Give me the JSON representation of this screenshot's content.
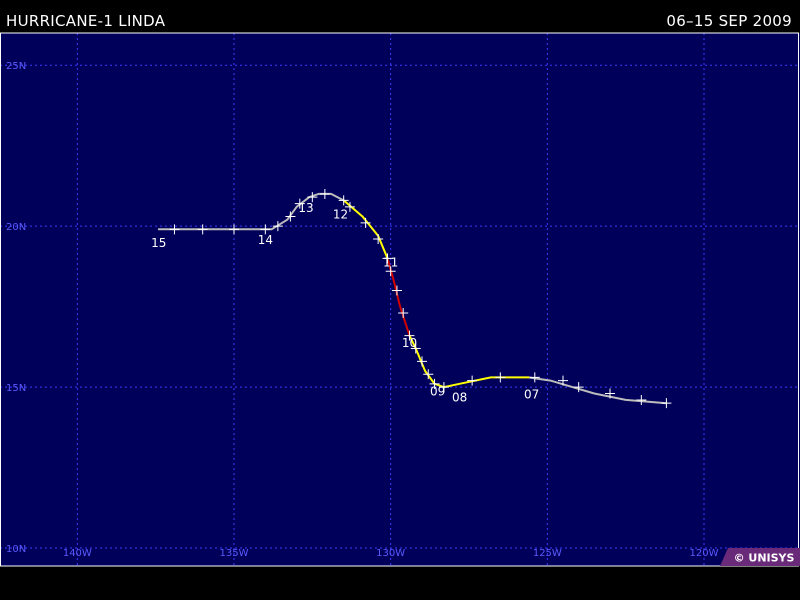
{
  "header": {
    "storm_name": "HURRICANE-1 LINDA",
    "dates": "06–15 SEP 2009"
  },
  "map": {
    "lon_range": [
      -141,
      -117
    ],
    "lat_range": [
      10,
      26
    ],
    "lon_ticks": [
      {
        "value": -140,
        "label": "140W"
      },
      {
        "value": -135,
        "label": "135W"
      },
      {
        "value": -130,
        "label": "130W"
      },
      {
        "value": -125,
        "label": "125W"
      },
      {
        "value": -120,
        "label": "120W"
      }
    ],
    "lat_ticks": [
      {
        "value": 10,
        "label": "10N"
      },
      {
        "value": 15,
        "label": "15N"
      },
      {
        "value": 20,
        "label": "20N"
      },
      {
        "value": 25,
        "label": "25N"
      }
    ],
    "colors": {
      "ocean": "#00005a",
      "grid": "#3b3bff",
      "tropical_storm": "#ffff00",
      "hurricane_1": "#d40000",
      "extratropical_or_depression": "#bcbcbc",
      "marker": "#ffffff"
    }
  },
  "track": {
    "segments": [
      {
        "category": "depression",
        "color_key": "extratropical_or_depression",
        "points": [
          [
            -121.2,
            14.5
          ],
          [
            -122.5,
            14.6
          ],
          [
            -123.5,
            14.8
          ],
          [
            -124.2,
            15.0
          ],
          [
            -124.9,
            15.2
          ],
          [
            -125.6,
            15.3
          ]
        ]
      },
      {
        "category": "tropical_storm",
        "color_key": "tropical_storm",
        "points": [
          [
            -125.6,
            15.3
          ],
          [
            -126.8,
            15.3
          ],
          [
            -127.8,
            15.1
          ],
          [
            -128.3,
            15.0
          ],
          [
            -128.6,
            15.1
          ],
          [
            -128.9,
            15.5
          ],
          [
            -129.2,
            16.2
          ],
          [
            -129.4,
            16.6
          ]
        ]
      },
      {
        "category": "hurricane_1",
        "color_key": "hurricane_1",
        "points": [
          [
            -129.4,
            16.6
          ],
          [
            -129.7,
            17.5
          ],
          [
            -129.9,
            18.3
          ],
          [
            -130.1,
            19.0
          ]
        ]
      },
      {
        "category": "tropical_storm",
        "color_key": "tropical_storm",
        "points": [
          [
            -130.1,
            19.0
          ],
          [
            -130.4,
            19.7
          ],
          [
            -130.9,
            20.3
          ],
          [
            -131.5,
            20.8
          ]
        ]
      },
      {
        "category": "depression",
        "color_key": "extratropical_or_depression",
        "points": [
          [
            -131.5,
            20.8
          ],
          [
            -131.9,
            21.0
          ],
          [
            -132.3,
            21.0
          ],
          [
            -132.6,
            20.9
          ],
          [
            -133.0,
            20.6
          ],
          [
            -133.3,
            20.2
          ],
          [
            -133.8,
            19.9
          ],
          [
            -134.5,
            19.9
          ],
          [
            -135.5,
            19.9
          ],
          [
            -136.5,
            19.9
          ],
          [
            -137.4,
            19.9
          ]
        ]
      }
    ],
    "markers": [
      [
        -121.2,
        14.5
      ],
      [
        -122.0,
        14.6
      ],
      [
        -123.0,
        14.8
      ],
      [
        -124.0,
        15.0
      ],
      [
        -124.5,
        15.2
      ],
      [
        -125.4,
        15.3
      ],
      [
        -126.5,
        15.3
      ],
      [
        -127.4,
        15.2
      ],
      [
        -128.3,
        15.0
      ],
      [
        -128.6,
        15.1
      ],
      [
        -128.8,
        15.4
      ],
      [
        -129.0,
        15.8
      ],
      [
        -129.2,
        16.2
      ],
      [
        -129.4,
        16.6
      ],
      [
        -129.6,
        17.3
      ],
      [
        -129.8,
        18.0
      ],
      [
        -130.0,
        18.6
      ],
      [
        -130.1,
        19.0
      ],
      [
        -130.4,
        19.6
      ],
      [
        -130.8,
        20.1
      ],
      [
        -131.3,
        20.6
      ],
      [
        -131.5,
        20.8
      ],
      [
        -132.1,
        21.0
      ],
      [
        -132.5,
        20.9
      ],
      [
        -132.9,
        20.7
      ],
      [
        -133.2,
        20.3
      ],
      [
        -133.6,
        20.0
      ],
      [
        -134.0,
        19.9
      ],
      [
        -135.0,
        19.9
      ],
      [
        -136.0,
        19.9
      ],
      [
        -136.9,
        19.9
      ]
    ],
    "day_labels": [
      {
        "label": "07",
        "lon": -125.5,
        "lat": 14.8
      },
      {
        "label": "08",
        "lon": -127.8,
        "lat": 14.7
      },
      {
        "label": "09",
        "lon": -128.5,
        "lat": 14.9
      },
      {
        "label": "10",
        "lon": -129.4,
        "lat": 16.4
      },
      {
        "label": "11",
        "lon": -130.0,
        "lat": 18.9
      },
      {
        "label": "12",
        "lon": -131.6,
        "lat": 20.4
      },
      {
        "label": "13",
        "lon": -132.7,
        "lat": 20.6
      },
      {
        "label": "14",
        "lon": -134.0,
        "lat": 19.6
      },
      {
        "label": "15",
        "lon": -137.4,
        "lat": 19.5
      }
    ]
  },
  "credit": "© UNISYS"
}
